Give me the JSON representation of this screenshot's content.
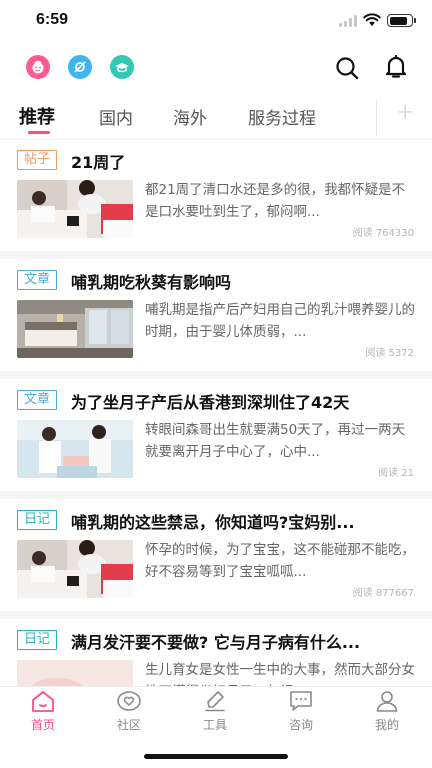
{
  "status_bar": {
    "time": "6:59",
    "battery_level": 0.85
  },
  "header": {
    "icons": [
      {
        "name": "baby-face-icon",
        "color": "#ff5a8f"
      },
      {
        "name": "pacifier-icon",
        "color": "#3db6f0"
      },
      {
        "name": "graduation-cap-icon",
        "color": "#35c7b5"
      }
    ],
    "search_icon": "search-icon",
    "notification_icon": "bell-icon"
  },
  "tabs": {
    "items": [
      "推荐",
      "国内",
      "海外",
      "服务过程"
    ],
    "active_index": 0,
    "add_label": "+"
  },
  "feed": [
    {
      "tag": "帖子",
      "tag_color": "orange",
      "title": "21周了",
      "excerpt": "都21周了清口水还是多的很，我都怀疑是不是口水要吐到生了，郁闷啊...",
      "reads": "阅读 764330",
      "image": "nurse-taking-blood-pressure-image"
    },
    {
      "tag": "文章",
      "tag_color": "blue",
      "title": "哺乳期吃秋葵有影响吗",
      "excerpt": "哺乳期是指产后产妇用自己的乳汁喂养婴儿的时期，由于婴儿体质弱，...",
      "reads": "阅读 5372",
      "image": "hotel-room-image"
    },
    {
      "tag": "文章",
      "tag_color": "blue",
      "title": "为了坐月子产后从香港到深圳住了42天",
      "excerpt": "转眼间森哥出生就要满50天了，再过一两天就要离开月子中心了，心中...",
      "reads": "阅读 21",
      "image": "doctors-examining-baby-image"
    },
    {
      "tag": "日记",
      "tag_color": "teal",
      "title": "哺乳期的这些禁忌，你知道吗?宝妈别...",
      "excerpt": "怀孕的时候，为了宝宝，这不能碰那不能吃，好不容易等到了宝宝呱呱...",
      "reads": "阅读 877667",
      "image": "nurse-taking-blood-pressure-image"
    },
    {
      "tag": "日记",
      "tag_color": "teal",
      "title": "满月发汗要不要做? 它与月子病有什么...",
      "excerpt": "生儿育女是女性一生中的大事，然而大部分女性不懂得坐好月子，忽视...",
      "reads": "",
      "image": "baby-skin-image"
    }
  ],
  "tabbar": {
    "items": [
      {
        "label": "首页",
        "icon": "home-icon"
      },
      {
        "label": "社区",
        "icon": "community-heart-icon"
      },
      {
        "label": "工具",
        "icon": "pencil-tool-icon"
      },
      {
        "label": "咨询",
        "icon": "chat-bubble-icon"
      },
      {
        "label": "我的",
        "icon": "profile-icon"
      }
    ],
    "active_index": 0
  },
  "colors": {
    "accent": "#ff4b8b",
    "text_primary": "#111111",
    "text_secondary": "#666666"
  }
}
